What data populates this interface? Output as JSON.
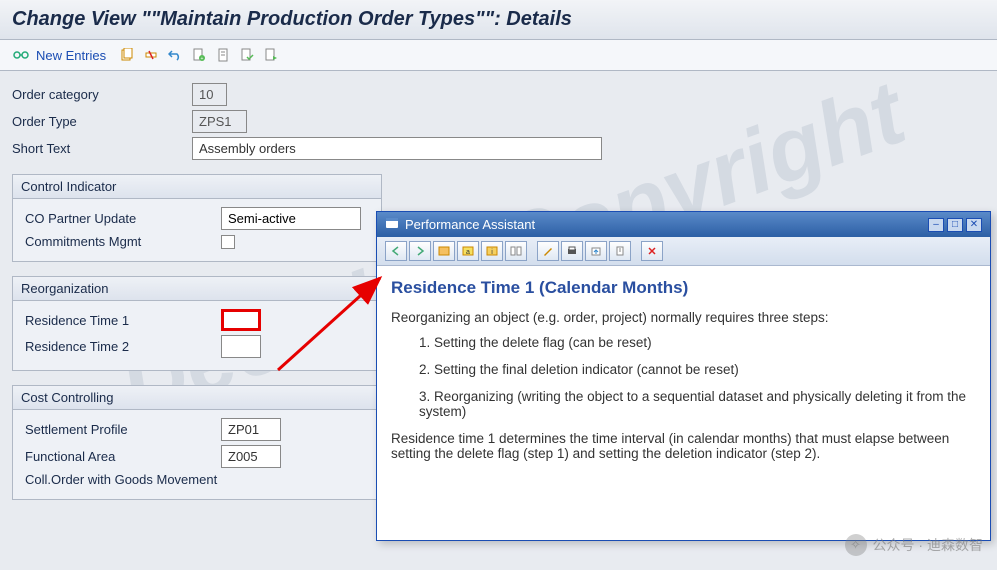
{
  "title": "Change View \"\"Maintain Production Order Types\"\": Details",
  "toolbar": {
    "new_entries": "New Entries"
  },
  "fields": {
    "order_category_label": "Order category",
    "order_category_value": "10",
    "order_type_label": "Order Type",
    "order_type_value": "ZPS1",
    "short_text_label": "Short Text",
    "short_text_value": "Assembly orders"
  },
  "groups": {
    "control_indicator": {
      "title": "Control Indicator",
      "co_partner_label": "CO Partner Update",
      "co_partner_value": "Semi-active",
      "commitments_label": "Commitments Mgmt"
    },
    "reorganization": {
      "title": "Reorganization",
      "res1_label": "Residence Time 1",
      "res1_value": "",
      "res2_label": "Residence Time 2",
      "res2_value": ""
    },
    "cost_controlling": {
      "title": "Cost Controlling",
      "settlement_label": "Settlement Profile",
      "settlement_value": "ZP01",
      "functional_label": "Functional Area",
      "functional_value": "Z005",
      "coll_order_label": "Coll.Order with Goods Movement"
    }
  },
  "popup": {
    "title": "Performance Assistant",
    "heading": "Residence Time 1 (Calendar Months)",
    "intro": "Reorganizing an object (e.g. order, project) normally requires three steps:",
    "step1": "1. Setting the delete flag (can be reset)",
    "step2": "2. Setting the final deletion indicator (cannot be reset)",
    "step3": "3. Reorganizing (writing the object to a sequential dataset and physically deleting it from the system)",
    "footer": "Residence time 1 determines the time interval (in calendar months) that must elapse between setting the delete flag (step 1) and setting the deletion indicator (step 2)."
  },
  "watermark": "Decision Copyright",
  "wechat": "公众号 · 迪森数智"
}
